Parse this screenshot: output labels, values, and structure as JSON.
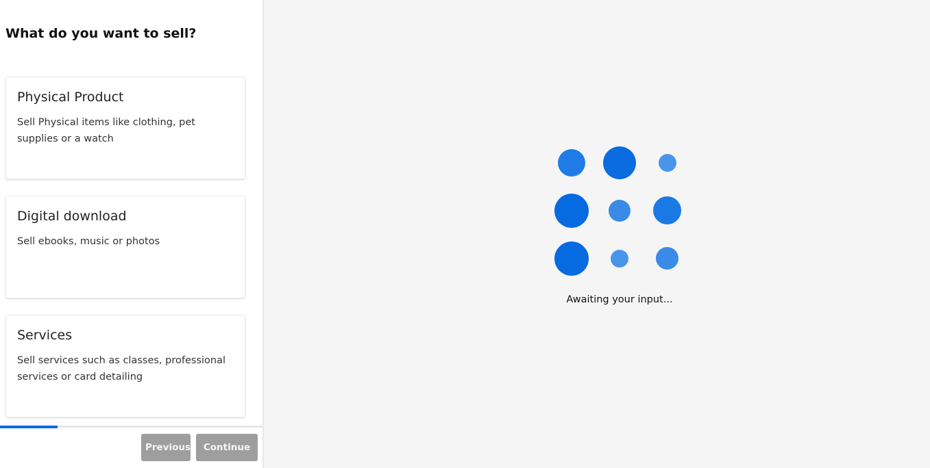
{
  "left_panel": {
    "title": "What do you want to sell?",
    "options": [
      {
        "title": "Physical Product",
        "description": "Sell Physical items like clothing, pet supplies or a watch"
      },
      {
        "title": "Digital download",
        "description": "Sell ebooks, music or photos"
      },
      {
        "title": "Services",
        "description": "Sell services such as classes, professional services or card detailing"
      }
    ],
    "progress_percent": 22,
    "buttons": {
      "previous": "Previous",
      "continue": "Continue"
    }
  },
  "right_panel": {
    "status_text": "Awaiting your input...",
    "loader_icon": "dots-grid-loader-icon",
    "accent_color": "#0a6ce0"
  }
}
